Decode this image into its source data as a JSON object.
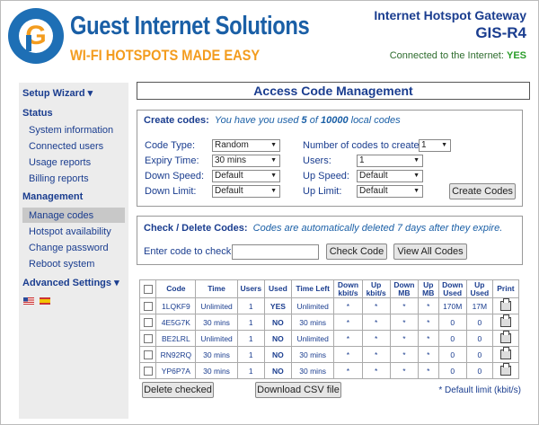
{
  "header": {
    "brand": "Guest Internet Solutions",
    "tagline": "WI-FI HOTSPOTS MADE EASY",
    "product_line": "Internet Hotspot Gateway",
    "model": "GIS-R4",
    "connected_label": "Connected to the Internet:",
    "connected_value": "YES"
  },
  "sidebar": {
    "setup_wizard": "Setup Wizard ▾",
    "status": "Status",
    "status_items": [
      "System information",
      "Connected users",
      "Usage reports",
      "Billing reports"
    ],
    "management": "Management",
    "management_items": [
      "Manage codes",
      "Hotspot availability",
      "Change password",
      "Reboot system"
    ],
    "advanced": "Advanced Settings ▾"
  },
  "page_title": "Access Code Management",
  "create": {
    "label": "Create codes:",
    "hint_pre": "You have you used",
    "used": "5",
    "hint_mid": "of",
    "limit": "10000",
    "hint_post": "local codes",
    "code_type_label": "Code Type:",
    "code_type": "Random",
    "expiry_label": "Expiry Time:",
    "expiry": "30 mins",
    "down_speed_label": "Down Speed:",
    "down_speed": "Default",
    "down_limit_label": "Down Limit:",
    "down_limit": "Default",
    "num_label": "Number of codes to create:",
    "num": "1",
    "users_label": "Users:",
    "users": "1",
    "up_speed_label": "Up Speed:",
    "up_speed": "Default",
    "up_limit_label": "Up Limit:",
    "up_limit": "Default",
    "button": "Create Codes"
  },
  "check": {
    "label": "Check / Delete Codes:",
    "hint": "Codes are automatically deleted 7 days after they expire.",
    "enter_label": "Enter code to check:",
    "input_value": "",
    "check_button": "Check Code",
    "view_all_button": "View All Codes"
  },
  "table": {
    "headers": [
      "Code",
      "Time",
      "Users",
      "Used",
      "Time Left",
      "Down kbit/s",
      "Up kbit/s",
      "Down MB",
      "Up MB",
      "Down Used",
      "Up Used",
      "Print"
    ],
    "rows": [
      [
        "1LQKF9",
        "Unlimited",
        "1",
        "YES",
        "Unlimited",
        "*",
        "*",
        "*",
        "*",
        "170M",
        "17M"
      ],
      [
        "4E5G7K",
        "30 mins",
        "1",
        "NO",
        "30 mins",
        "*",
        "*",
        "*",
        "*",
        "0",
        "0"
      ],
      [
        "BE2LRL",
        "Unlimited",
        "1",
        "NO",
        "Unlimited",
        "*",
        "*",
        "*",
        "*",
        "0",
        "0"
      ],
      [
        "RN92RQ",
        "30 mins",
        "1",
        "NO",
        "30 mins",
        "*",
        "*",
        "*",
        "*",
        "0",
        "0"
      ],
      [
        "YP6P7A",
        "30 mins",
        "1",
        "NO",
        "30 mins",
        "*",
        "*",
        "*",
        "*",
        "0",
        "0"
      ]
    ]
  },
  "actions": {
    "delete_button": "Delete checked",
    "download_button": "Download CSV file",
    "footnote": "* Default limit (kbit/s)"
  }
}
